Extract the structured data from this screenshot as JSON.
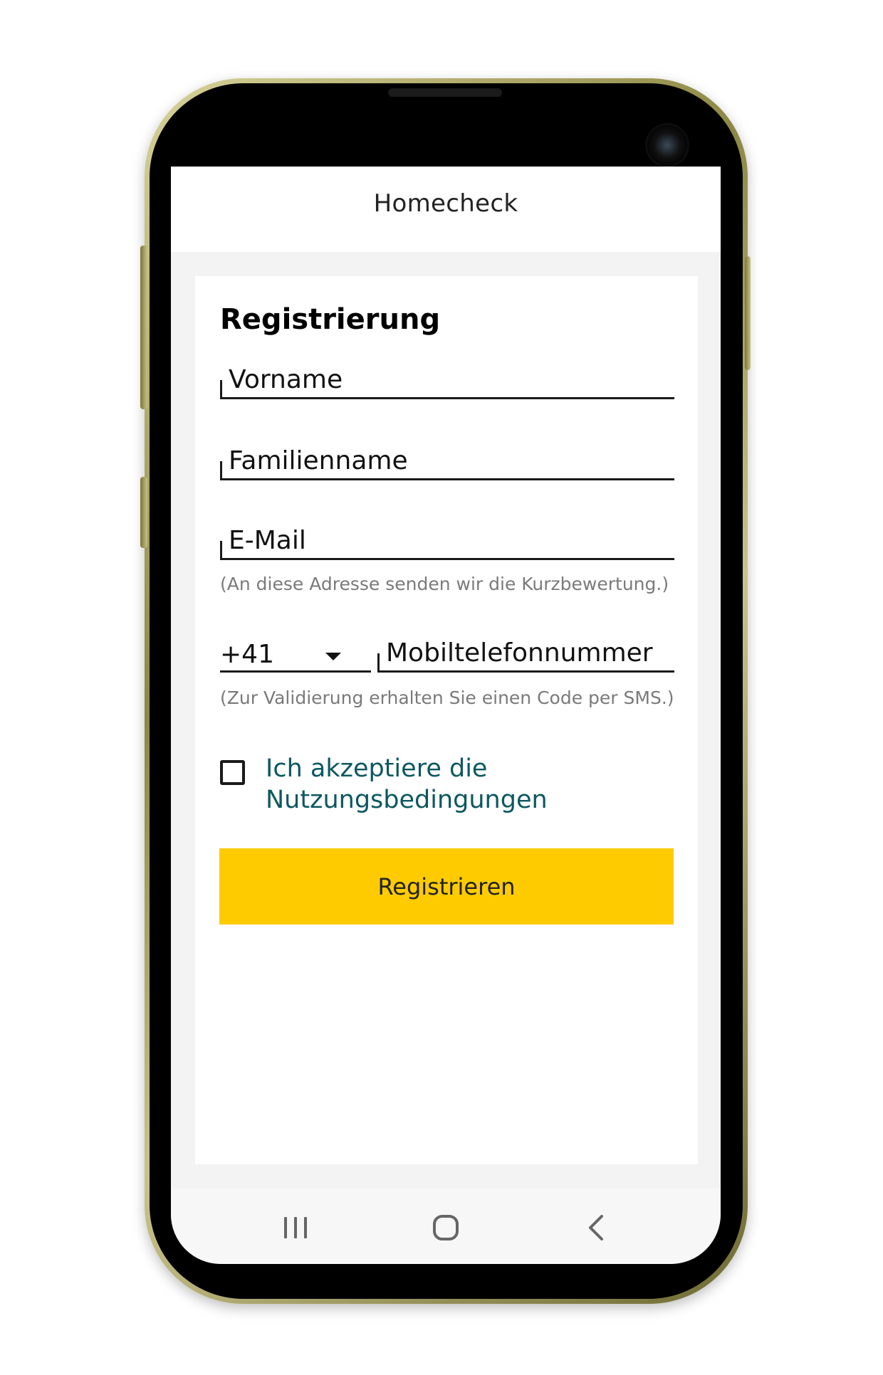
{
  "app_bar": {
    "title": "Homecheck"
  },
  "form": {
    "heading": "Registrierung",
    "first_name": {
      "placeholder": "Vorname",
      "value": ""
    },
    "last_name": {
      "placeholder": "Familienname",
      "value": ""
    },
    "email": {
      "placeholder": "E-Mail",
      "value": "",
      "helper": "(An diese Adresse senden wir die Kurzbewertung.)"
    },
    "phone": {
      "country_code": "+41",
      "placeholder": "Mobiltelefonnummer",
      "value": "",
      "helper": "(Zur Validierung erhalten Sie einen Code per SMS.)"
    },
    "terms": {
      "label": "Ich akzeptiere die Nutzungsbedingungen",
      "checked": false
    },
    "submit_label": "Registrieren"
  },
  "system_nav": {
    "recents_icon": "recents-icon",
    "home_icon": "home-icon",
    "back_icon": "back-icon"
  },
  "colors": {
    "accent": "#fecb00",
    "link": "#0d5860",
    "background": "#f3f3f3",
    "card": "#ffffff",
    "frame": "#a39e5a"
  }
}
